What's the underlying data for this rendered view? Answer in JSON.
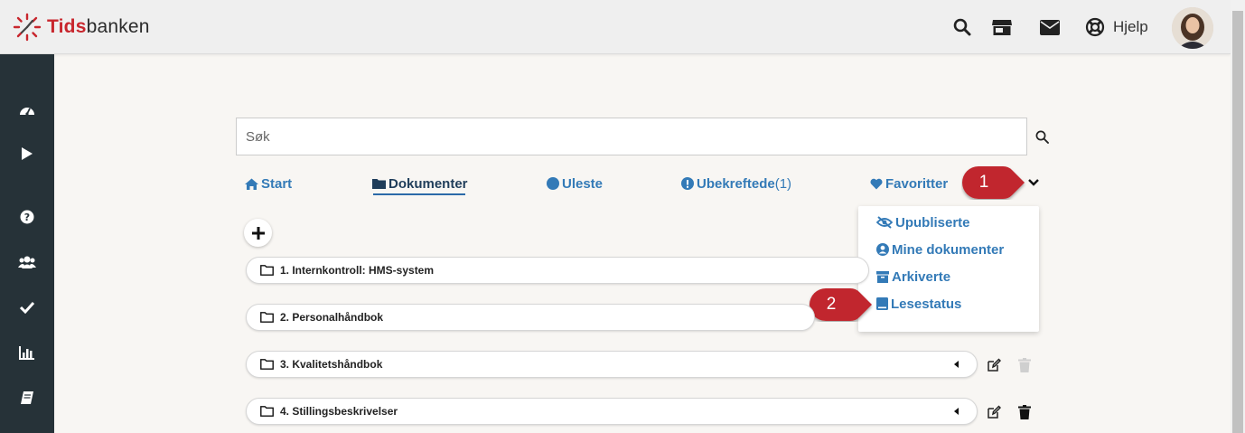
{
  "app": {
    "logo_bold": "Tids",
    "logo_rest": "banken"
  },
  "header": {
    "icons": [
      "search-icon",
      "store-icon",
      "envelope-icon",
      "lifebuoy-icon"
    ],
    "help_label": "Hjelp"
  },
  "sidebar": {
    "icons": [
      "dashboard-icon",
      "play-icon",
      "question-icon",
      "users-icon",
      "check-icon",
      "bar-chart-icon",
      "book-icon"
    ]
  },
  "search": {
    "placeholder": "Søk"
  },
  "tabs": {
    "start": "Start",
    "dokumenter": "Dokumenter",
    "uleste": "Uleste",
    "ubekreftede": "Ubekreftede",
    "ubekreftede_count": "(1)",
    "favoritter": "Favoritter"
  },
  "dropdown": {
    "items": [
      "Upubliserte",
      "Mine dokumenter",
      "Arkiverte",
      "Lesestatus"
    ]
  },
  "callouts": {
    "one": "1",
    "two": "2"
  },
  "folders": [
    "1. Internkontroll: HMS-system",
    "2. Personalhåndbok",
    "3. Kvalitetshåndbok",
    "4. Stillingsbeskrivelser"
  ],
  "colors": {
    "link": "#337ab7",
    "sidebar": "#263238",
    "callout": "#c1272d",
    "logo_red": "#c8262d"
  }
}
